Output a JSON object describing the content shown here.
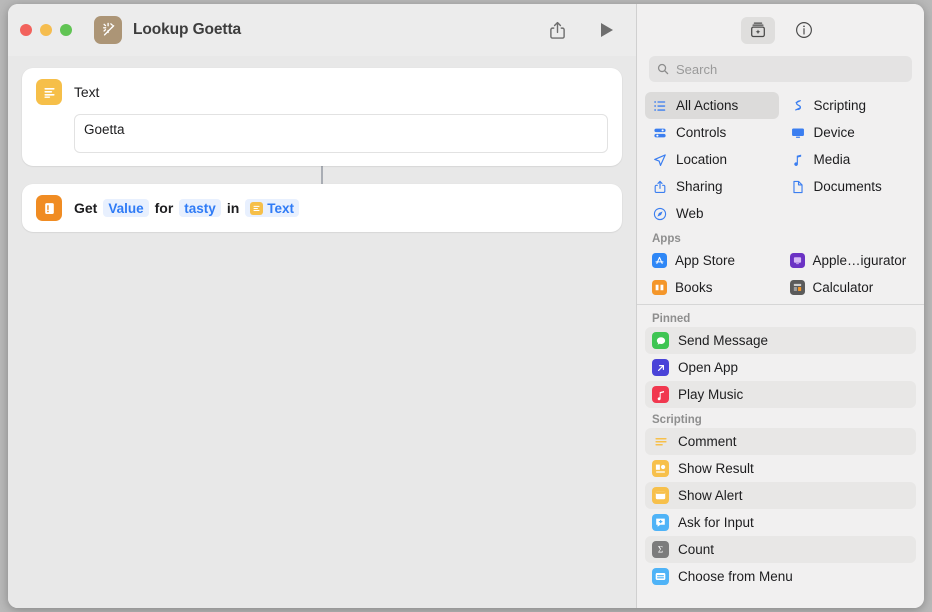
{
  "window": {
    "title": "Lookup Goetta",
    "app_icon": "magic-wand-icon",
    "traffic_lights": [
      "close",
      "minimize",
      "zoom"
    ]
  },
  "toolbar": {
    "share_label": "share-icon",
    "play_label": "play-icon"
  },
  "workflow": {
    "actions": [
      {
        "title": "Text",
        "icon": "text-lines-icon",
        "icon_color": "#f6bf49",
        "field_value": "Goetta"
      },
      {
        "icon": "dictionary-icon",
        "icon_color": "#f08c23",
        "parts": [
          {
            "type": "word",
            "text": "Get"
          },
          {
            "type": "token",
            "text": "Value"
          },
          {
            "type": "word",
            "text": "for"
          },
          {
            "type": "token",
            "text": "tasty"
          },
          {
            "type": "word",
            "text": "in"
          },
          {
            "type": "token",
            "text": "Text",
            "mini_icon": "text-lines-icon"
          }
        ]
      }
    ]
  },
  "sidebar": {
    "tools": [
      {
        "name": "action-library-icon",
        "active": true
      },
      {
        "name": "info-icon",
        "active": false
      }
    ],
    "search": {
      "placeholder": "Search",
      "value": "",
      "icon": "search-icon"
    },
    "categories": [
      {
        "label": "All Actions",
        "icon": "list-icon",
        "selected": true
      },
      {
        "label": "Scripting",
        "icon": "scripting-icon",
        "selected": false
      },
      {
        "label": "Controls",
        "icon": "controls-icon",
        "selected": false
      },
      {
        "label": "Device",
        "icon": "display-icon",
        "selected": false
      },
      {
        "label": "Location",
        "icon": "location-arrow-icon",
        "selected": false
      },
      {
        "label": "Media",
        "icon": "music-note-icon",
        "selected": false
      },
      {
        "label": "Sharing",
        "icon": "share-up-icon",
        "selected": false
      },
      {
        "label": "Documents",
        "icon": "document-icon",
        "selected": false
      },
      {
        "label": "Web",
        "icon": "safari-compass-icon",
        "selected": false
      }
    ],
    "apps_section": {
      "label": "Apps",
      "items": [
        {
          "label": "App Store",
          "icon": "app-store-icon",
          "color": "#2f87f6"
        },
        {
          "label": "Apple…igurator",
          "icon": "apple-configurator-icon",
          "color": "#6b32c4"
        },
        {
          "label": "Books",
          "icon": "books-icon",
          "color": "#f4962a"
        },
        {
          "label": "Calculator",
          "icon": "calculator-icon",
          "color": "#5b5b5b"
        }
      ]
    },
    "pinned_section": {
      "label": "Pinned",
      "items": [
        {
          "label": "Send Message",
          "icon": "message-bubble-icon",
          "color": "#3fc553",
          "alt": true
        },
        {
          "label": "Open App",
          "icon": "open-app-arrow-icon",
          "color": "#4a43d8",
          "alt": false
        },
        {
          "label": "Play Music",
          "icon": "music-note-red-icon",
          "color": "#f1384f",
          "alt": true
        }
      ]
    },
    "scripting_section": {
      "label": "Scripting",
      "items": [
        {
          "label": "Comment",
          "icon": "comment-lines-icon",
          "color": "#ffffff",
          "alt": true
        },
        {
          "label": "Show Result",
          "icon": "show-result-icon",
          "color": "#f7c04b",
          "alt": false
        },
        {
          "label": "Show Alert",
          "icon": "show-alert-icon",
          "color": "#f7c04b",
          "alt": true
        },
        {
          "label": "Ask for Input",
          "icon": "ask-for-input-icon",
          "color": "#4fb3f7",
          "alt": false
        },
        {
          "label": "Count",
          "icon": "count-sigma-icon",
          "color": "#7c7c7c",
          "alt": true
        },
        {
          "label": "Choose from Menu",
          "icon": "choose-from-menu-icon",
          "color": "#4fb3f7",
          "alt": false
        }
      ]
    }
  }
}
